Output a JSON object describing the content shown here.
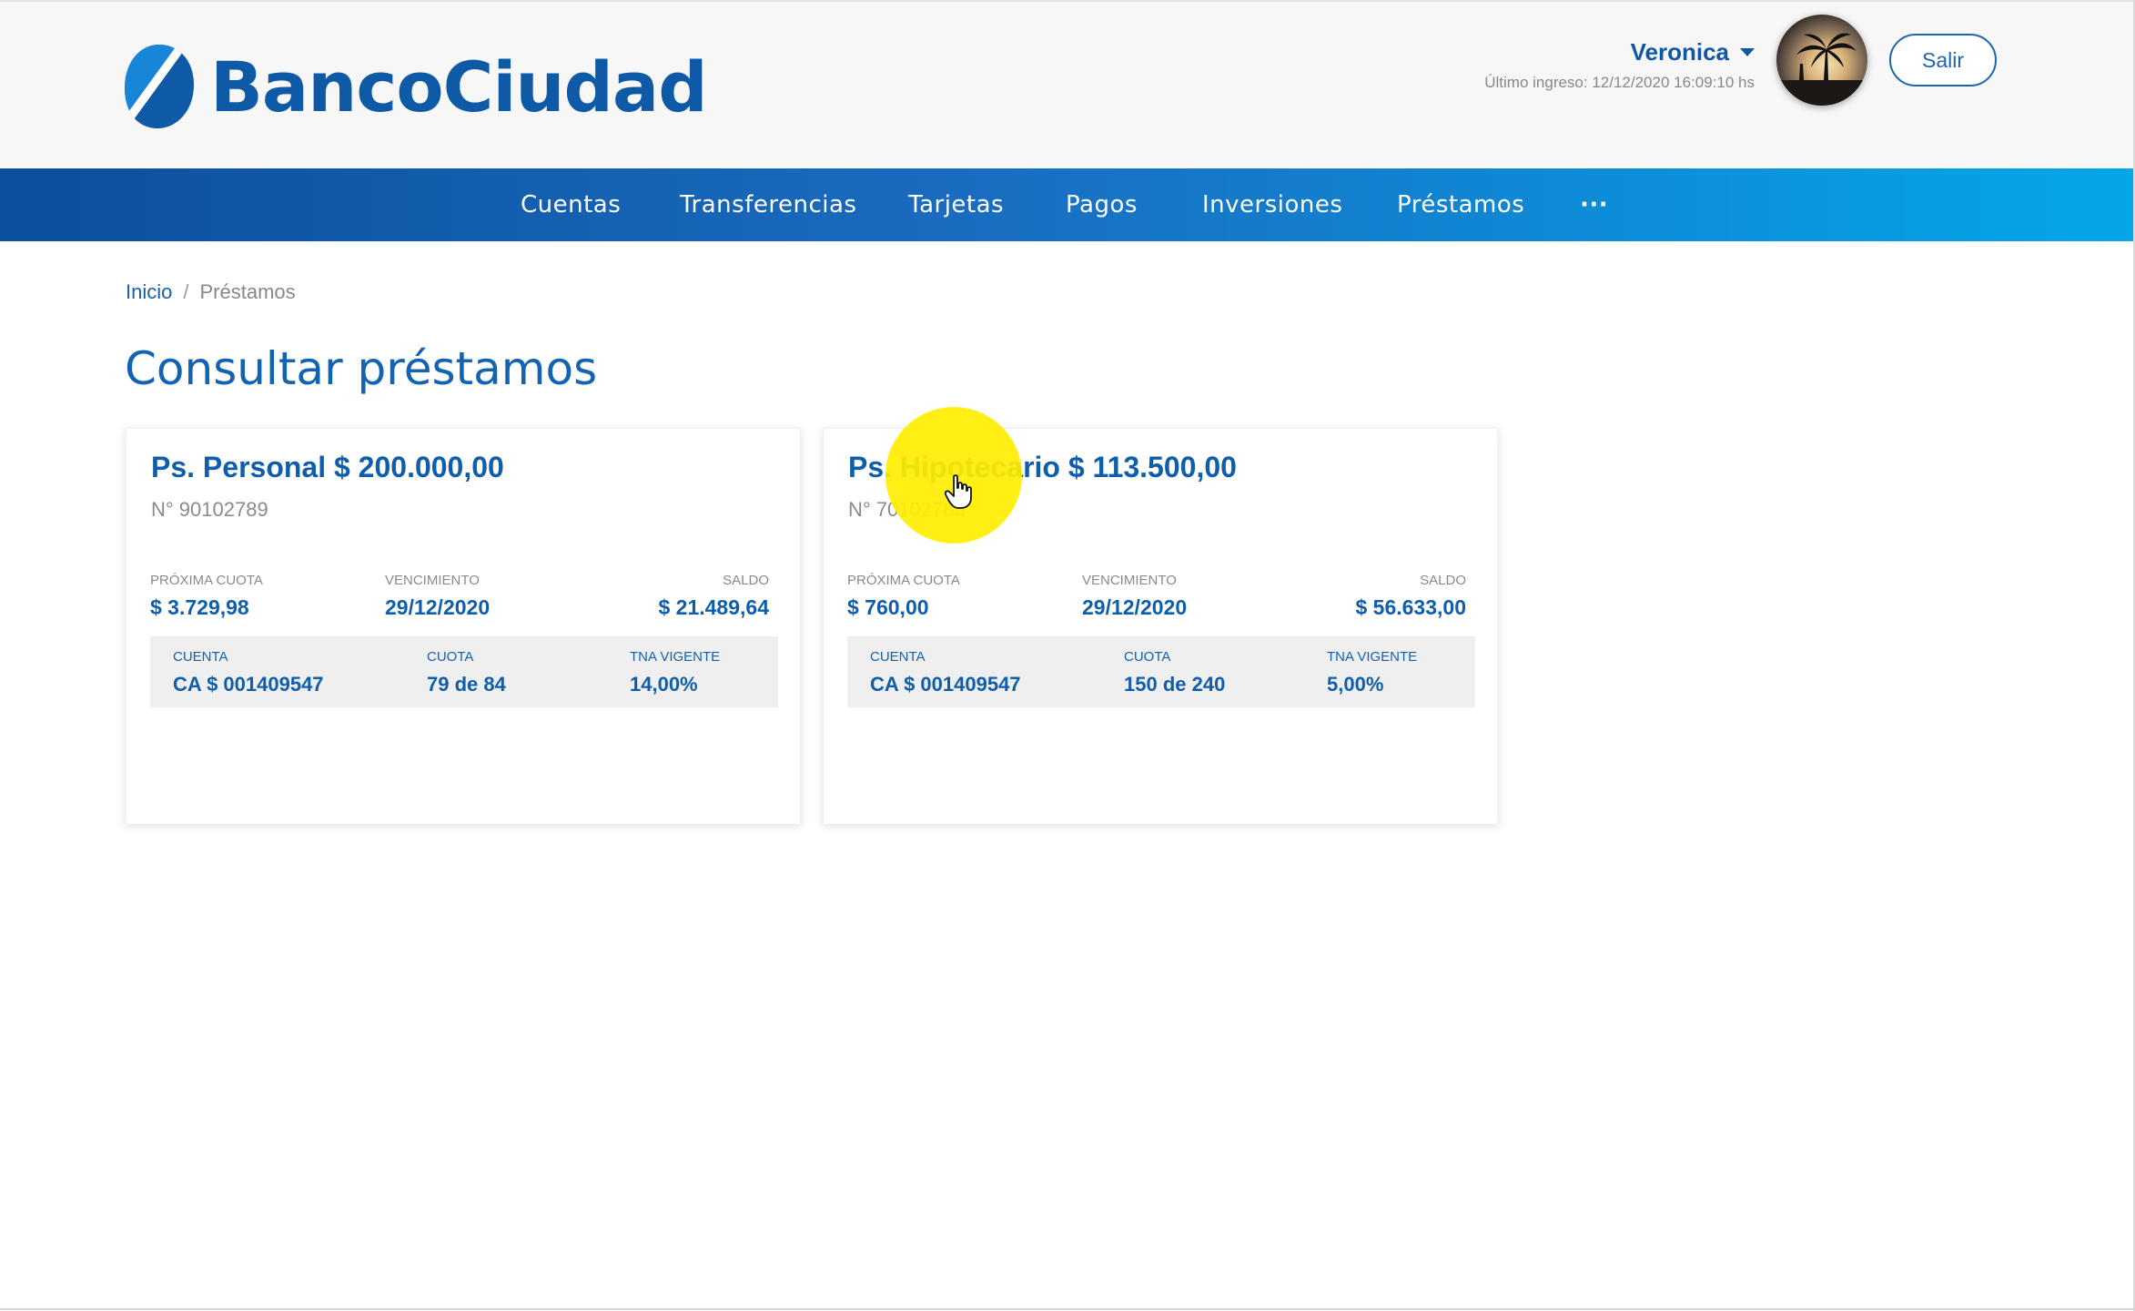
{
  "brand": {
    "name": "BancoCiudad",
    "primary": "#0e5aa7"
  },
  "user": {
    "name": "Veronica",
    "last_login": "Último ingreso: 12/12/2020 16:09:10 hs",
    "logout_label": "Salir"
  },
  "nav": {
    "items": [
      "Cuentas",
      "Transferencias",
      "Tarjetas",
      "Pagos",
      "Inversiones",
      "Préstamos",
      "···"
    ]
  },
  "breadcrumb": {
    "home": "Inicio",
    "separator": "/",
    "current": "Préstamos"
  },
  "page_title": "Consultar préstamos",
  "loans": [
    {
      "title": "Ps. Personal $ 200.000,00",
      "number": "N° 90102789",
      "next_installment_label": "PRÓXIMA CUOTA",
      "next_installment": "$ 3.729,98",
      "due_label": "VENCIMIENTO",
      "due": "29/12/2020",
      "balance_label": "SALDO",
      "balance": "$ 21.489,64",
      "account_label": "CUENTA",
      "account": "CA $ 001409547",
      "installment_label": "CUOTA",
      "installment": "79 de 84",
      "rate_label": "TNA VIGENTE",
      "rate": "14,00%"
    },
    {
      "title": "Ps. Hipotecario $ 113.500,00",
      "number": "N° 70102783",
      "next_installment_label": "PRÓXIMA CUOTA",
      "next_installment": "$ 760,00",
      "due_label": "VENCIMIENTO",
      "due": "29/12/2020",
      "balance_label": "SALDO",
      "balance": "$ 56.633,00",
      "account_label": "CUENTA",
      "account": "CA $ 001409547",
      "installment_label": "CUOTA",
      "installment": "150 de 240",
      "rate_label": "TNA VIGENTE",
      "rate": "5,00%"
    }
  ]
}
